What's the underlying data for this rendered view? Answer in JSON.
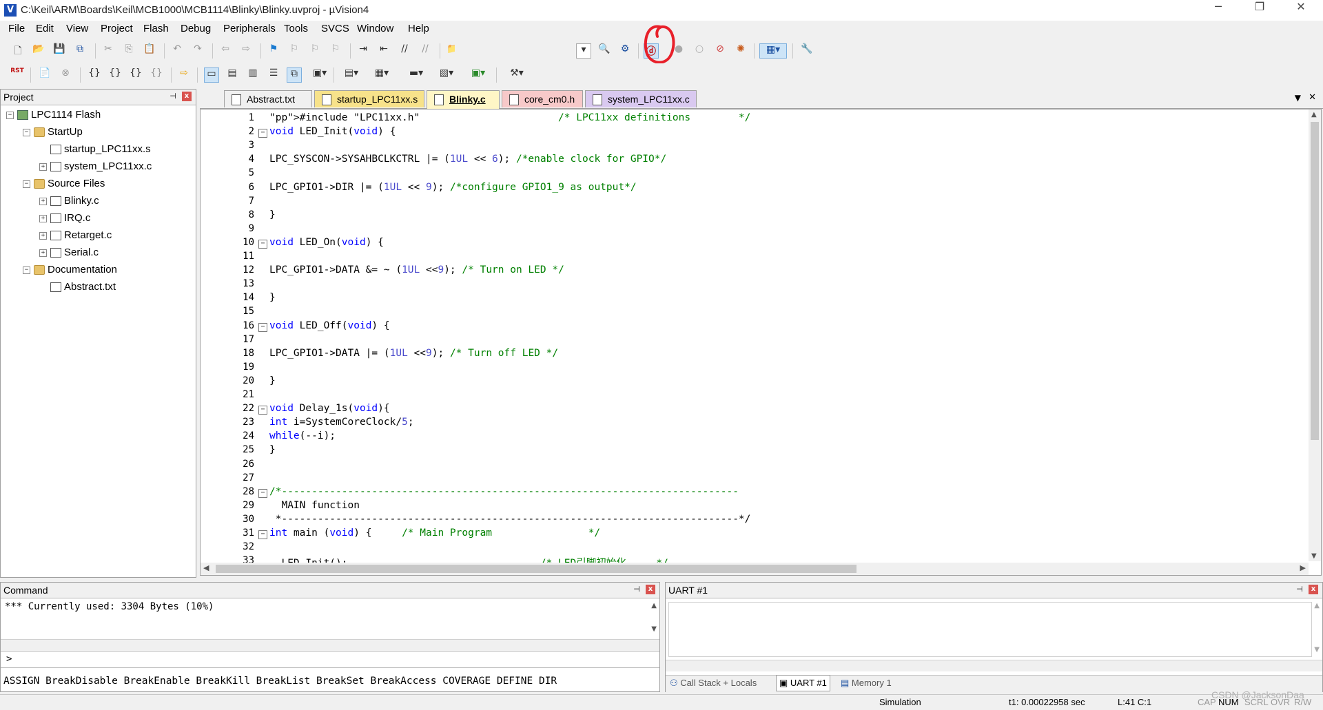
{
  "window": {
    "title": "C:\\Keil\\ARM\\Boards\\Keil\\MCB1000\\MCB1114\\Blinky\\Blinky.uvproj - µVision4",
    "app_icon": "V",
    "minimize": "─",
    "restore": "❐",
    "close": "✕"
  },
  "menu": [
    "File",
    "Edit",
    "View",
    "Project",
    "Flash",
    "Debug",
    "Peripherals",
    "Tools",
    "SVCS",
    "Window",
    "Help"
  ],
  "toolbar1": {
    "icons": [
      "new-file-icon",
      "open-folder-icon",
      "save-icon",
      "save-all-icon",
      "cut-icon",
      "copy-icon",
      "paste-icon",
      "undo-icon",
      "redo-icon",
      "nav-back-icon",
      "nav-forward-icon",
      "bookmark-icon",
      "prev-bookmark-icon",
      "next-bookmark-icon",
      "clear-bookmarks-icon",
      "indent-icon",
      "unindent-icon",
      "comment-icon",
      "uncomment-icon",
      "find-in-files-icon",
      "config-dropdown-icon",
      "find-icon",
      "incremental-find-icon",
      "start-debug-icon",
      "insert-breakpoint-icon",
      "enable-breakpoint-icon",
      "disable-breakpoints-icon",
      "kill-breakpoints-icon",
      "window-layout-icon",
      "settings-wrench-icon"
    ]
  },
  "toolbar2": {
    "rst_label": "RST",
    "icons": [
      "reset-icon",
      "run-icon",
      "stop-icon",
      "step-in-icon",
      "step-over-icon",
      "step-out-icon",
      "run-to-cursor-icon",
      "show-next-statement-icon",
      "command-window-icon",
      "disassembly-window-icon",
      "symbols-window-icon",
      "registers-window-icon",
      "call-stack-icon",
      "watch-window-icon",
      "memory-window-icon",
      "serial-window-icon",
      "analysis-window-icon",
      "trace-window-icon",
      "system-viewer-icon",
      "toolbox-icon"
    ]
  },
  "project_panel": {
    "title": "Project",
    "pin": "⊣",
    "close": "x",
    "tree": [
      {
        "label": "LPC1114 Flash",
        "level": 0,
        "toggle": "−",
        "kind": "project"
      },
      {
        "label": "StartUp",
        "level": 1,
        "toggle": "−",
        "kind": "folder"
      },
      {
        "label": "startup_LPC11xx.s",
        "level": 2,
        "toggle": "",
        "kind": "file"
      },
      {
        "label": "system_LPC11xx.c",
        "level": 2,
        "toggle": "+",
        "kind": "file"
      },
      {
        "label": "Source Files",
        "level": 1,
        "toggle": "−",
        "kind": "folder"
      },
      {
        "label": "Blinky.c",
        "level": 2,
        "toggle": "+",
        "kind": "file"
      },
      {
        "label": "IRQ.c",
        "level": 2,
        "toggle": "+",
        "kind": "file"
      },
      {
        "label": "Retarget.c",
        "level": 2,
        "toggle": "+",
        "kind": "file"
      },
      {
        "label": "Serial.c",
        "level": 2,
        "toggle": "+",
        "kind": "file"
      },
      {
        "label": "Documentation",
        "level": 1,
        "toggle": "−",
        "kind": "folder"
      },
      {
        "label": "Abstract.txt",
        "level": 2,
        "toggle": "",
        "kind": "file"
      }
    ]
  },
  "editor": {
    "tabs": [
      {
        "label": "Abstract.txt",
        "color": "#f0f0f0",
        "active": false
      },
      {
        "label": "startup_LPC11xx.s",
        "color": "#f7e28a",
        "active": false
      },
      {
        "label": "Blinky.c",
        "color": "#fff6c6",
        "active": true
      },
      {
        "label": "core_cm0.h",
        "color": "#f7c9c9",
        "active": false
      },
      {
        "label": "system_LPC11xx.c",
        "color": "#d9c9f0",
        "active": false
      }
    ],
    "tab_menu": "▼",
    "tab_close": "✕",
    "lines": [
      {
        "n": "1",
        "fold": "",
        "code": "#include \"LPC11xx.h\"                       /* LPC11xx definitions        */"
      },
      {
        "n": "2",
        "fold": "−",
        "code": "void LED_Init(void) {"
      },
      {
        "n": "3",
        "fold": "",
        "code": ""
      },
      {
        "n": "4",
        "fold": "",
        "code": "LPC_SYSCON->SYSAHBCLKCTRL |= (1UL << 6); /*enable clock for GPIO*/"
      },
      {
        "n": "5",
        "fold": "",
        "code": ""
      },
      {
        "n": "6",
        "fold": "",
        "code": "LPC_GPIO1->DIR |= (1UL << 9); /*configure GPIO1_9 as output*/"
      },
      {
        "n": "7",
        "fold": "",
        "code": ""
      },
      {
        "n": "8",
        "fold": "",
        "code": "}"
      },
      {
        "n": "9",
        "fold": "",
        "code": ""
      },
      {
        "n": "10",
        "fold": "−",
        "code": "void LED_On(void) {"
      },
      {
        "n": "11",
        "fold": "",
        "code": ""
      },
      {
        "n": "12",
        "fold": "",
        "code": "LPC_GPIO1->DATA &= ~ (1UL <<9); /* Turn on LED */"
      },
      {
        "n": "13",
        "fold": "",
        "code": ""
      },
      {
        "n": "14",
        "fold": "",
        "code": "}"
      },
      {
        "n": "15",
        "fold": "",
        "code": ""
      },
      {
        "n": "16",
        "fold": "−",
        "code": "void LED_Off(void) {"
      },
      {
        "n": "17",
        "fold": "",
        "code": ""
      },
      {
        "n": "18",
        "fold": "",
        "code": "LPC_GPIO1->DATA |= (1UL <<9); /* Turn off LED */"
      },
      {
        "n": "19",
        "fold": "",
        "code": ""
      },
      {
        "n": "20",
        "fold": "",
        "code": "}"
      },
      {
        "n": "21",
        "fold": "",
        "code": ""
      },
      {
        "n": "22",
        "fold": "−",
        "code": "void Delay_1s(void){"
      },
      {
        "n": "23",
        "fold": "",
        "code": "int i=SystemCoreClock/5;"
      },
      {
        "n": "24",
        "fold": "",
        "code": "while(--i);"
      },
      {
        "n": "25",
        "fold": "",
        "code": "}"
      },
      {
        "n": "26",
        "fold": "",
        "code": ""
      },
      {
        "n": "27",
        "fold": "",
        "code": ""
      },
      {
        "n": "28",
        "fold": "−",
        "code": "/*----------------------------------------------------------------------------"
      },
      {
        "n": "29",
        "fold": "",
        "code": "  MAIN function"
      },
      {
        "n": "30",
        "fold": "",
        "code": " *----------------------------------------------------------------------------*/"
      },
      {
        "n": "31",
        "fold": "−",
        "code": "int main (void) {     /* Main Program                */"
      },
      {
        "n": "32",
        "fold": "",
        "code": ""
      },
      {
        "n": "33",
        "fold": "",
        "code": "  LED_Init();                                /* LED引脚初始化     */"
      }
    ]
  },
  "command_panel": {
    "title": "Command",
    "output": "*** Currently used: 3304 Bytes (10%)",
    "prompt": ">",
    "hints": "ASSIGN BreakDisable BreakEnable BreakKill BreakList BreakSet BreakAccess COVERAGE DEFINE DIR"
  },
  "uart_panel": {
    "title": "UART #1",
    "tabs": [
      "Call Stack + Locals",
      "UART #1",
      "Memory 1"
    ]
  },
  "statusbar": {
    "mode": "Simulation",
    "time": "t1: 0.00022958 sec",
    "cursor": "L:41 C:1",
    "caps": "CAP",
    "num": "NUM",
    "scrl": "SCRL",
    "ovr": "OVR",
    "rw": "R/W",
    "watermark": "CSDN @JacksonDaa"
  },
  "colors": {
    "accent_circle": "#e8202a",
    "keyword": "#0000ff",
    "comment": "#008000",
    "string": "#a31515"
  }
}
